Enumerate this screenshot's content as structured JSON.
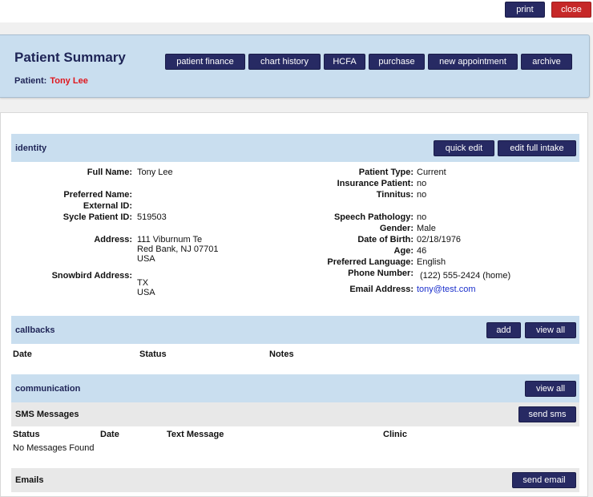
{
  "toolbar": {
    "print": "print",
    "close": "close"
  },
  "header": {
    "title": "Patient Summary",
    "patient_label": "Patient:",
    "patient_name": "Tony Lee",
    "buttons": [
      "patient finance",
      "chart history",
      "HCFA",
      "purchase",
      "new appointment",
      "archive"
    ]
  },
  "identity": {
    "title": "identity",
    "quick_edit": "quick edit",
    "edit_full_intake": "edit full intake",
    "left": {
      "full_name_label": "Full Name:",
      "full_name": "Tony Lee",
      "preferred_name_label": "Preferred Name:",
      "preferred_name": "",
      "external_id_label": "External ID:",
      "external_id": "",
      "sycle_id_label": "Sycle Patient ID:",
      "sycle_id": "519503",
      "address_label": "Address:",
      "address_line1": "111 Viburnum Te",
      "address_line2": "Red Bank, NJ 07701",
      "address_line3": "USA",
      "snowbird_label": "Snowbird Address:",
      "snowbird_line1": "TX",
      "snowbird_line2": "USA"
    },
    "right": {
      "patient_type_label": "Patient Type:",
      "patient_type": "Current",
      "insurance_label": "Insurance Patient:",
      "insurance": "no",
      "tinnitus_label": "Tinnitus:",
      "tinnitus": "no",
      "speech_label": "Speech Pathology:",
      "speech": "no",
      "gender_label": "Gender:",
      "gender": "Male",
      "dob_label": "Date of Birth:",
      "dob": "02/18/1976",
      "age_label": "Age:",
      "age": "46",
      "language_label": "Preferred Language:",
      "language": "English",
      "phone_label": "Phone Number:",
      "phone": "(122) 555-2424 (home)",
      "email_label": "Email Address:",
      "email": "tony@test.com"
    }
  },
  "callbacks": {
    "title": "callbacks",
    "add": "add",
    "view_all": "view all",
    "columns": [
      "Date",
      "Status",
      "Notes"
    ]
  },
  "communication": {
    "title": "communication",
    "view_all": "view all",
    "sms": {
      "title": "SMS Messages",
      "send": "send sms",
      "columns": [
        "Status",
        "Date",
        "Text Message",
        "Clinic"
      ],
      "empty": "No Messages Found"
    },
    "emails": {
      "title": "Emails",
      "send": "send email"
    }
  }
}
